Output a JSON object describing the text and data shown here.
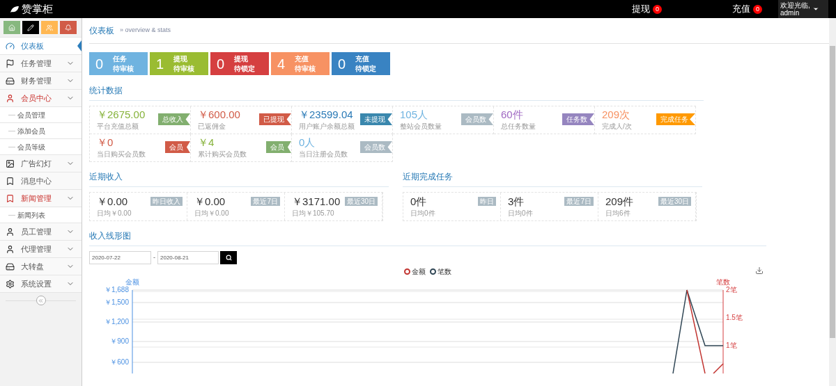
{
  "header": {
    "logo": "赞掌柜",
    "links": [
      {
        "label": "提现",
        "count": "0"
      },
      {
        "label": "充值",
        "count": "0"
      }
    ],
    "user": {
      "greeting": "欢迎光临,",
      "name": "admin"
    }
  },
  "sidebar": {
    "items": [
      {
        "label": "仪表板",
        "selected": true
      },
      {
        "label": "任务管理",
        "selected": false,
        "expanded": false
      },
      {
        "label": "财务管理",
        "selected": false,
        "expanded": false
      },
      {
        "label": "会员中心",
        "selected": false,
        "expanded": true,
        "children": [
          {
            "label": "会员管理"
          },
          {
            "label": "添加会员"
          },
          {
            "label": "会员等级"
          }
        ]
      },
      {
        "label": "广告幻灯",
        "selected": false,
        "expanded": false
      },
      {
        "label": "消息中心",
        "selected": false
      },
      {
        "label": "新闻管理",
        "selected": false,
        "expanded": true,
        "children": [
          {
            "label": "新闻列表"
          }
        ]
      },
      {
        "label": "员工管理",
        "selected": false,
        "expanded": false
      },
      {
        "label": "代理管理",
        "selected": false,
        "expanded": false
      },
      {
        "label": "大转盘",
        "selected": false,
        "expanded": false
      },
      {
        "label": "系统设置",
        "selected": false,
        "expanded": false
      }
    ]
  },
  "breadcrumb": {
    "title": "仪表板",
    "subtitle": "» overview & stats"
  },
  "tiles": [
    {
      "count": "0",
      "line_1": "任务",
      "line_2": "待审核",
      "color": "#6fb3e0"
    },
    {
      "count": "1",
      "line_1": "提现",
      "line_2": "待审核",
      "color": "#9abc32"
    },
    {
      "count": "0",
      "line_1": "提现",
      "line_2": "待锁定",
      "color": "#d53f40"
    },
    {
      "count": "4",
      "line_1": "充值",
      "line_2": "待审核",
      "color": "#f79263"
    },
    {
      "count": "0",
      "line_1": "充值",
      "line_2": "待锁定",
      "color": "#3983c2"
    }
  ],
  "stats": {
    "title": "统计数据",
    "items": [
      {
        "value": "￥2675.00",
        "badge": {
          "label": "总收入",
          "color": "#82af6f"
        },
        "caption": "平台充值总额",
        "color": "#87b33c"
      },
      {
        "value": "￥600.00",
        "badge": {
          "label": "已提现",
          "color": "#d15b47"
        },
        "caption": "已返佣金",
        "color": "#d15b47"
      },
      {
        "value": "￥23599.04",
        "badge": {
          "label": "未提现",
          "color": "#3a87ad"
        },
        "caption": "用户账户余额总额",
        "color": "#2a7ab6"
      },
      {
        "value": "105人",
        "badge": {
          "label": "会员数",
          "color": "#abbac3"
        },
        "caption": "整站会员数量",
        "color": "#6fb3e0"
      },
      {
        "value": "60件",
        "badge": {
          "label": "任务数",
          "color": "#9585bf"
        },
        "caption": "总任务数量",
        "color": "#a069c3"
      },
      {
        "value": "209次",
        "badge": {
          "label": "完成任务",
          "color": "#ff9900"
        },
        "caption": "完成人/次",
        "color": "#f79263"
      },
      {
        "value": "￥0",
        "badge": {
          "label": "会员",
          "color": "#d15b47"
        },
        "caption": "当日购买会员数",
        "color": "#d15b47"
      },
      {
        "value": "￥4",
        "badge": {
          "label": "会员",
          "color": "#82af6f"
        },
        "caption": "累计购买会员数",
        "color": "#87b33c"
      },
      {
        "value": "0人",
        "badge": {
          "label": "会员数",
          "color": "#abbac3"
        },
        "caption": "当日注册会员数",
        "color": "#6fb3e0"
      }
    ]
  },
  "recent_income": {
    "title": "近期收入",
    "items": [
      {
        "value": "￥0.00",
        "badge": "昨日收入",
        "caption": "日均￥0.00"
      },
      {
        "value": "￥0.00",
        "badge": "最近7日",
        "caption": "日均￥0.00"
      },
      {
        "value": "￥3171.00",
        "badge": "最近30日",
        "caption": "日均￥105.70"
      }
    ]
  },
  "recent_tasks": {
    "title": "近期完成任务",
    "items": [
      {
        "value": "0件",
        "badge": "昨日",
        "caption": "日均0件"
      },
      {
        "value": "3件",
        "badge": "最近7日",
        "caption": "日均0件"
      },
      {
        "value": "209件",
        "badge": "最近30日",
        "caption": "日均6件"
      }
    ]
  },
  "income_chart": {
    "title": "收入线形图",
    "date_from": "2020-07-22",
    "separator": "-",
    "date_to": "2020-08-21",
    "legend": [
      {
        "name": "金额",
        "color": "#c23531"
      },
      {
        "name": "笔数",
        "color": "#2f4554"
      }
    ],
    "left_axis": {
      "title": "金额",
      "ticks": [
        "￥1,688",
        "￥1,500",
        "￥1,200",
        "￥900",
        "￥600"
      ]
    },
    "right_axis": {
      "title": "笔数",
      "ticks": [
        "2笔",
        "1.5笔",
        "1笔"
      ]
    }
  }
}
